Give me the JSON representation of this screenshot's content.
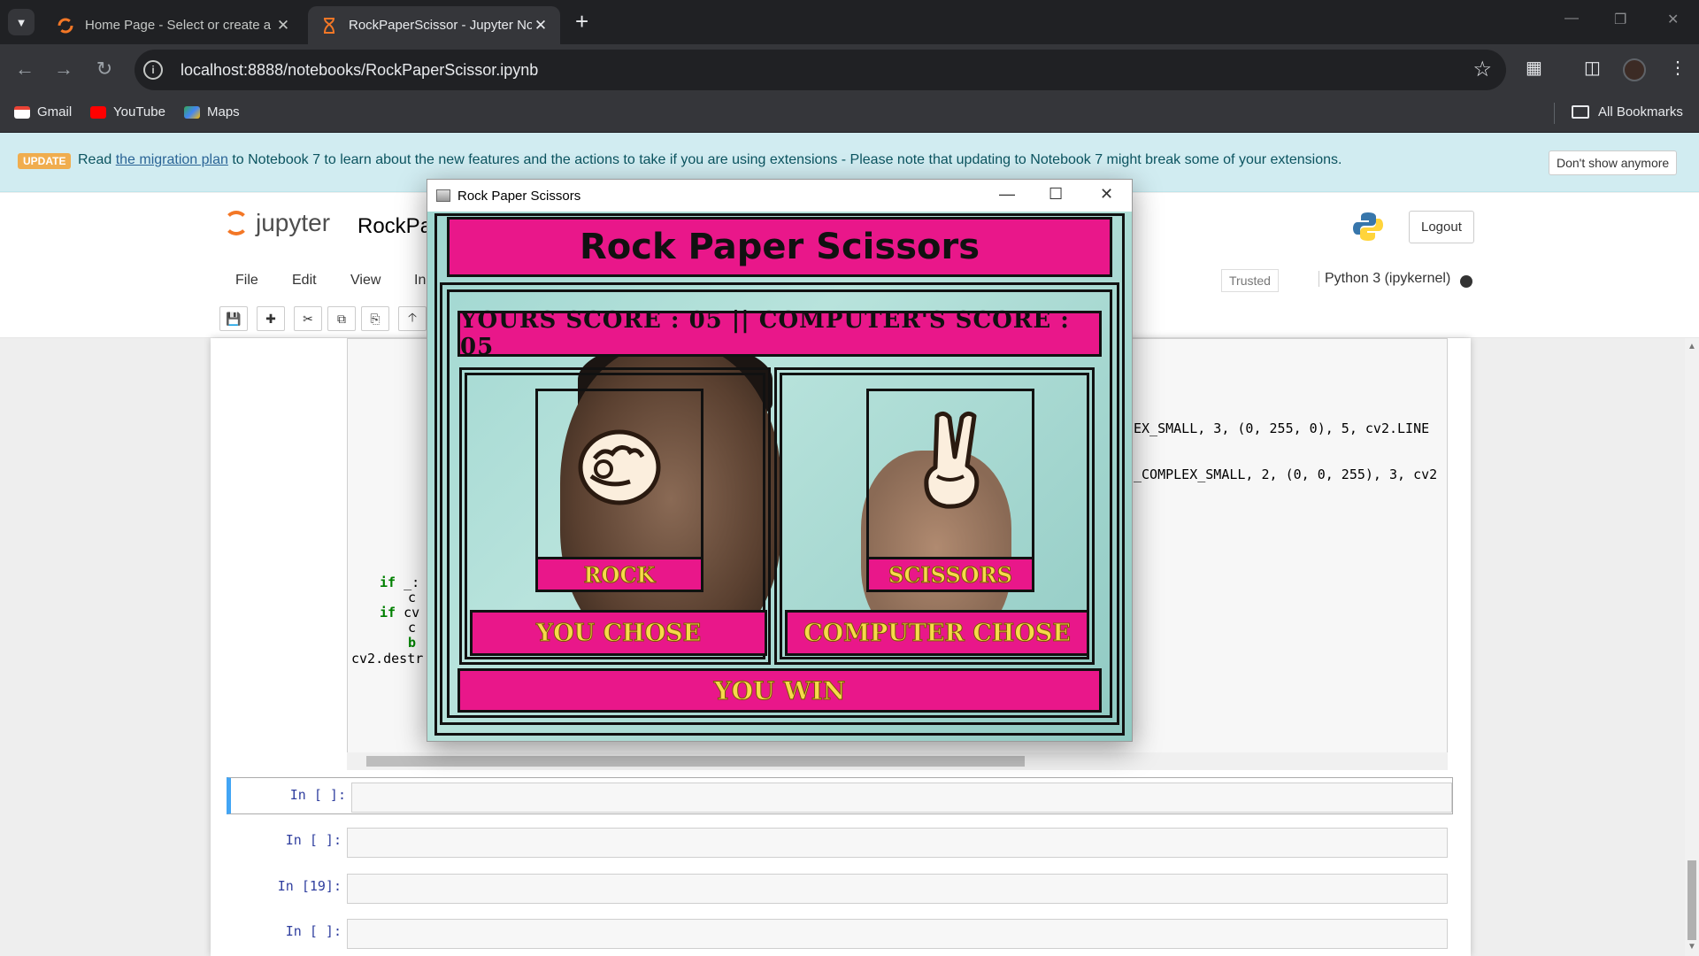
{
  "browser": {
    "tabs": [
      {
        "title": "Home Page - Select or create a",
        "active": false
      },
      {
        "title": "RockPaperScissor - Jupyter Not",
        "active": true
      }
    ],
    "url": "localhost:8888/notebooks/RockPaperScissor.ipynb",
    "bookmarks": [
      "Gmail",
      "YouTube",
      "Maps"
    ],
    "all_bookmarks": "All Bookmarks"
  },
  "banner": {
    "badge": "UPDATE",
    "text_before": "Read ",
    "link": "the migration plan",
    "text_after": " to Notebook 7 to learn about the new features and the actions to take if you are using extensions - Please note that updating to Notebook 7 might break some of your extensions.",
    "dismiss": "Don't show anymore"
  },
  "header": {
    "logo": "jupyter",
    "notebook_name": "RockPa",
    "logout": "Logout"
  },
  "menu": {
    "items": [
      "File",
      "Edit",
      "View",
      "In"
    ],
    "trusted": "Trusted",
    "kernel": "Python 3 (ipykernel)"
  },
  "code": {
    "line1": "EX_SMALL, 3, (0, 255, 0), 5, cv2.LINE",
    "line2": "_COMPLEX_SMALL, 2, (0, 0, 255), 3, cv2",
    "if1_kw": "if",
    "if1_rest": " _:",
    "if2_kw": "if",
    "if2_rest": " cv",
    "cont1": "c",
    "cont2": "c",
    "cont3": "b",
    "destroy": "cv2.destr"
  },
  "cells": [
    {
      "prompt": "In [ ]:",
      "selected": true
    },
    {
      "prompt": "In [ ]:",
      "selected": false
    },
    {
      "prompt": "In [19]:",
      "selected": false
    },
    {
      "prompt": "In [ ]:",
      "selected": false
    }
  ],
  "popup": {
    "window_title": "Rock Paper Scissors",
    "game_title": "Rock Paper Scissors",
    "score": "YOURS SCORE : 05 || COMPUTER'S SCORE : 05",
    "player_choice": "ROCK",
    "computer_choice": "SCISSORS",
    "player_label": "YOU CHOSE",
    "computer_label": "COMPUTER CHOSE",
    "result": "YOU WIN"
  },
  "colors": {
    "game_pink": "#e9178a",
    "game_yellow": "#f7d94a",
    "banner_bg": "#d1ecf1",
    "jupyter_orange": "#f37726"
  }
}
